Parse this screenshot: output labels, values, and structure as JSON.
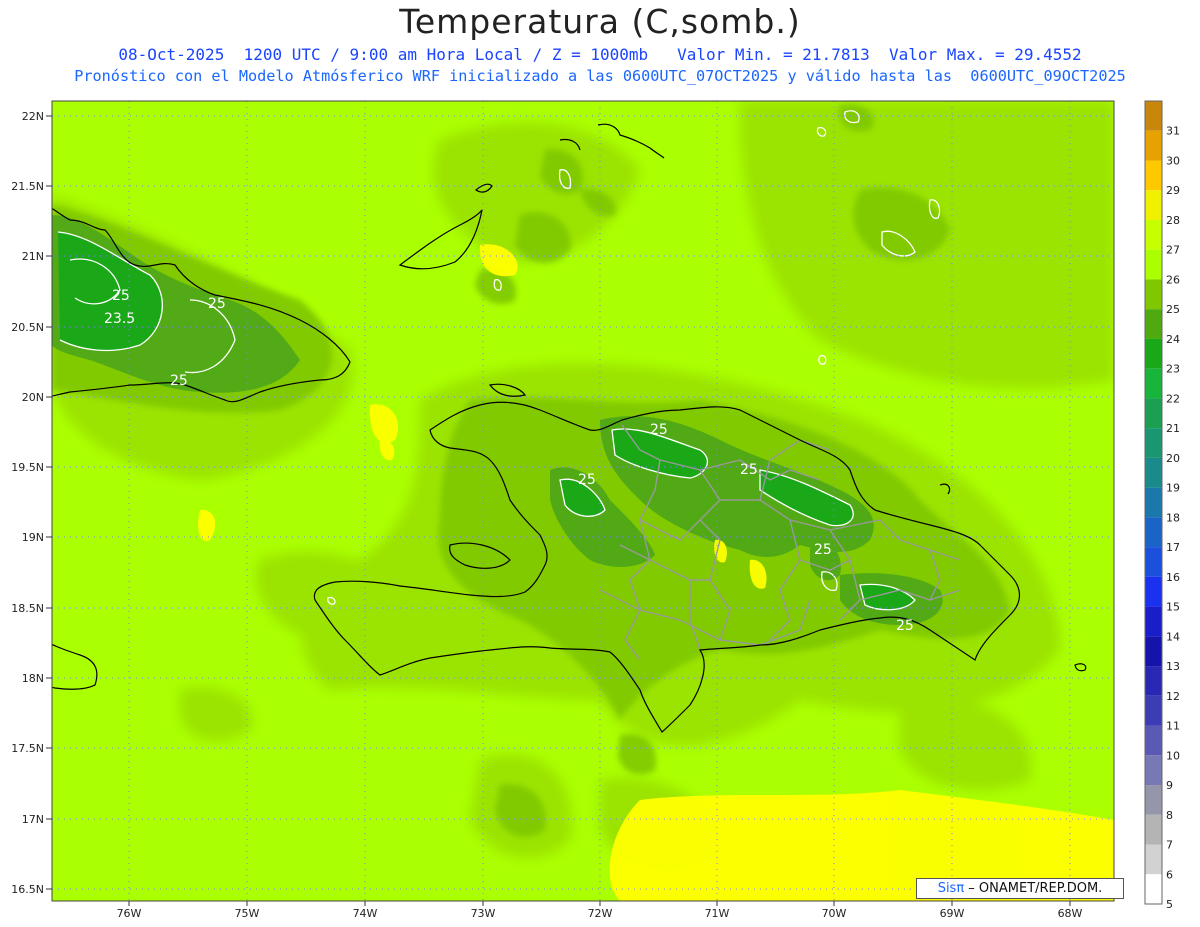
{
  "header": {
    "title": "Temperatura (C,somb.)",
    "line1": "08-Oct-2025  1200 UTC / 9:00 am Hora Local / Z = 1000mb   Valor Min. = 21.7813  Valor Max. = 29.4552",
    "line2": "Pronóstico con el Modelo Atmósferico WRF inicializado a las 0600UTC_07OCT2025 y válido hasta las  0600UTC_09OCT2025"
  },
  "axes": {
    "lat_labels": [
      "22N",
      "21.5N",
      "21N",
      "20.5N",
      "20N",
      "19.5N",
      "19N",
      "18.5N",
      "18N",
      "17.5N",
      "17N",
      "16.5N"
    ],
    "lon_labels": [
      "76W",
      "75W",
      "74W",
      "73W",
      "72W",
      "71W",
      "70W",
      "69W",
      "68W"
    ]
  },
  "colorbar": {
    "labels": [
      "31",
      "30",
      "29",
      "28",
      "27",
      "26",
      "25",
      "24",
      "23",
      "22",
      "21",
      "20",
      "19",
      "18",
      "17",
      "16",
      "15",
      "14",
      "13",
      "12",
      "11",
      "10",
      "9",
      "8",
      "7",
      "6",
      "5"
    ],
    "colors": [
      "#c8860a",
      "#e6a200",
      "#ffc800",
      "#f0f000",
      "#c8ff00",
      "#aaff00",
      "#7fc800",
      "#4faa10",
      "#18a818",
      "#19b43c",
      "#1aa050",
      "#1a9670",
      "#1a8a8a",
      "#1a78aa",
      "#1a64c8",
      "#1a50dc",
      "#1a32f0",
      "#1a1ec8",
      "#1414aa",
      "#2828b4",
      "#3c3cb4",
      "#5a5ab4",
      "#7878b4",
      "#9696aa",
      "#b4b4b4",
      "#d2d2d2",
      "#ffffff"
    ]
  },
  "contour_labels": [
    "25",
    "23.5",
    "25",
    "25",
    "25",
    "25",
    "25",
    "25",
    "25"
  ],
  "credit": {
    "sis": "Sis",
    "pi": "π",
    "org": " – ONAMET/REP.DOM."
  },
  "palette": {
    "background": "#aaff00",
    "shade1": "#9ae000",
    "shade2": "#7fc800",
    "shade3": "#4fa818",
    "shade4": "#18a818",
    "warm": "#ffff00",
    "coast": "#000000",
    "borders": "#999999",
    "grid": "#8080ff"
  }
}
